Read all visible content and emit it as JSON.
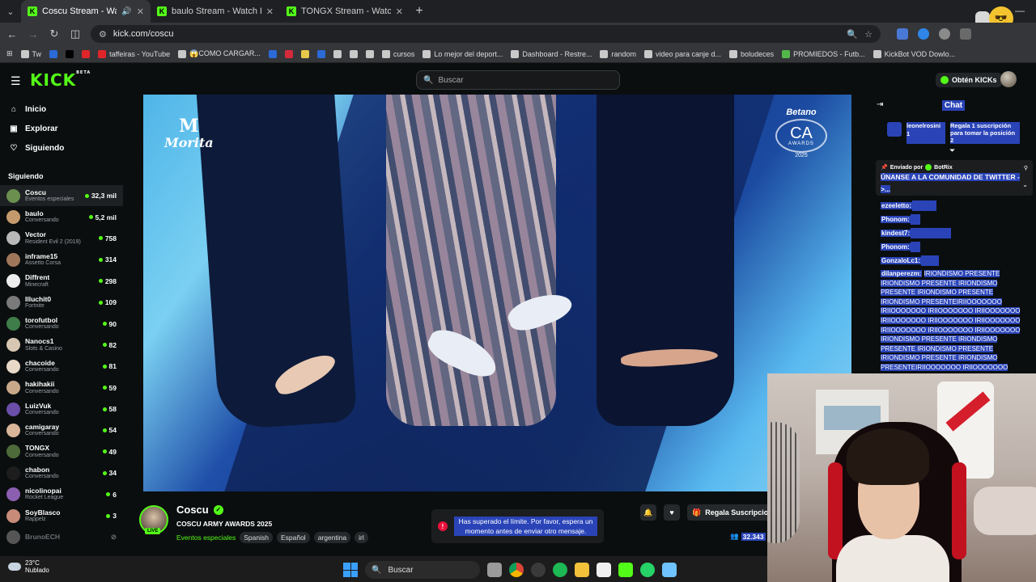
{
  "browser": {
    "tabs": [
      {
        "title": "Coscu Stream - Watch Live",
        "active": true,
        "audio": true
      },
      {
        "title": "baulo Stream - Watch Live on K",
        "active": false
      },
      {
        "title": "TONGX Stream - Watch Live on",
        "active": false
      }
    ],
    "url": "kick.com/coscu",
    "bookmarks": [
      {
        "label": "Tw",
        "color": "#c9c9c9"
      },
      {
        "label": "",
        "color": "#2b6ad7"
      },
      {
        "label": "",
        "color": "#000000"
      },
      {
        "label": "",
        "color": "#e0252a"
      },
      {
        "label": "taffeiras - YouTube",
        "color": "#e0252a"
      },
      {
        "label": "😱COMO CARGAR...",
        "color": "#c9c9c9"
      },
      {
        "label": "",
        "color": "#2b6ad7"
      },
      {
        "label": "",
        "color": "#d52a3c"
      },
      {
        "label": "",
        "color": "#e8c84a"
      },
      {
        "label": "",
        "color": "#2b6ad7"
      },
      {
        "label": "",
        "color": "#c9c9c9"
      },
      {
        "label": "",
        "color": "#c9c9c9"
      },
      {
        "label": "",
        "color": "#c9c9c9"
      },
      {
        "label": "cursos",
        "color": "#c9c9c9"
      },
      {
        "label": "Lo mejor del deport...",
        "color": "#c9c9c9"
      },
      {
        "label": "Dashboard - Restre...",
        "color": "#c9c9c9"
      },
      {
        "label": "random",
        "color": "#c9c9c9"
      },
      {
        "label": "video para canje d...",
        "color": "#c9c9c9"
      },
      {
        "label": "boludeces",
        "color": "#c9c9c9"
      },
      {
        "label": "PROMIEDOS - Futb...",
        "color": "#53b84a"
      },
      {
        "label": "KickBot VOD Dowlo...",
        "color": "#c9c9c9"
      }
    ]
  },
  "header": {
    "logo": "KICK",
    "logo_badge": "BETA",
    "search_placeholder": "Buscar",
    "kicks_button": "Obtén KICKs"
  },
  "sidebar": {
    "nav": [
      {
        "label": "Inicio",
        "icon": "home-icon",
        "glyph": "⌂"
      },
      {
        "label": "Explorar",
        "icon": "browse-icon",
        "glyph": "▣"
      },
      {
        "label": "Siguiendo",
        "icon": "heart-icon",
        "glyph": "♡"
      }
    ],
    "section_title": "Siguiendo",
    "following": [
      {
        "name": "Coscu",
        "category": "Eventos especiales",
        "viewers": "32,3 mil",
        "color": "#6b8f4e",
        "selected": true
      },
      {
        "name": "baulo",
        "category": "Conversando",
        "viewers": "5,2 mil",
        "color": "#c49a6c"
      },
      {
        "name": "Vector",
        "category": "Resident Evil 2 (2019)",
        "viewers": "758",
        "color": "#b8b8b8"
      },
      {
        "name": "inframe15",
        "category": "Assetto Corsa",
        "viewers": "314",
        "color": "#a0765a"
      },
      {
        "name": "Diffrent",
        "category": "Minecraft",
        "viewers": "298",
        "color": "#ededed"
      },
      {
        "name": "Illuchit0",
        "category": "Fortnite",
        "viewers": "109",
        "color": "#7a7a7a"
      },
      {
        "name": "torofutbol",
        "category": "Conversando",
        "viewers": "90",
        "color": "#3f7d4a"
      },
      {
        "name": "Nanocs1",
        "category": "Slots & Casino",
        "viewers": "82",
        "color": "#d7c7b2"
      },
      {
        "name": "chacoide",
        "category": "Conversando",
        "viewers": "81",
        "color": "#e8d9c8"
      },
      {
        "name": "hakihakii",
        "category": "Conversando",
        "viewers": "59",
        "color": "#c9a889"
      },
      {
        "name": "LuizVuk",
        "category": "Conversando",
        "viewers": "58",
        "color": "#6a4ea8"
      },
      {
        "name": "camigaray",
        "category": "Conversando",
        "viewers": "54",
        "color": "#d9b59a"
      },
      {
        "name": "TONGX",
        "category": "Conversando",
        "viewers": "49",
        "color": "#4d6b3a"
      },
      {
        "name": "chabon",
        "category": "Conversando",
        "viewers": "34",
        "color": "#1d1d1d"
      },
      {
        "name": "nicolinopai",
        "category": "Rocket League",
        "viewers": "6",
        "color": "#8a5fb0"
      },
      {
        "name": "SoyBlasco",
        "category": "Rappelz",
        "viewers": "3",
        "color": "#c78b7a"
      },
      {
        "name": "BrunoECH",
        "category": "",
        "viewers": "",
        "color": "#555555",
        "offline": true
      }
    ]
  },
  "video": {
    "watermark_left_mark": "M",
    "watermark_left_text": "Morita",
    "watermark_right_brand": "Betano",
    "watermark_right_mark": "CA",
    "watermark_right_sub": "AWARDS",
    "watermark_right_year": "2025"
  },
  "stream": {
    "channel": "Coscu",
    "live_badge": "LIVE",
    "title": "COSCU ARMY AWARDS 2025",
    "category": "Eventos especiales",
    "tags": [
      "Spanish",
      "Español",
      "argentina",
      "irl"
    ],
    "toast": "Has superado el límite. Por favor, espera un momento antes de enviar otro mensaje.",
    "gift_button": "Regala Suscripcio",
    "viewers": "32.343"
  },
  "chat": {
    "title": "Chat",
    "gifter_name": "leonelrosini 1",
    "gifter_message": "Regala 1 suscripción para tomar la posición 2",
    "pinned_by": "Enviado por",
    "pinned_bot": "BotRix",
    "pinned_message": "ÚNANSE A LA COMUNIDAD DE TWITTER ->...",
    "messages": [
      {
        "user": "ezeeletto:",
        "body": ""
      },
      {
        "user": "Phonom:",
        "body": ""
      },
      {
        "user": "kindest7:",
        "body": ""
      },
      {
        "user": "Phonom:",
        "body": ""
      },
      {
        "user": "GonzaloLc1:",
        "body": ""
      },
      {
        "user": "dilanperezm:",
        "body": "IRIONDISMO PRESENTE IRIONDISMO PRESENTE IRIONDISMO PRESENTE IRIONDISMO PRESENTE IRIONDISMO PRESENTEIRIIOOOOOOO IRIIOOOOOOO IRIIOOOOOOO IRIIOOOOOOO IRIIOOOOOOO IRIIOOOOOOO IRIIOOOOOOO IRIIOOOOOOO IRIIOOOOOOO IRIIOOOOOOO IRIONDISMO PRESENTE IRIONDISMO PRESENTE IRIONDISMO PRESENTE IRIONDISMO PRESENTE IRIONDISMO PRESENTEIRIIOOOOOOO IRIIOOOOOOO"
      }
    ]
  },
  "taskbar": {
    "weather_temp": "23°C",
    "weather_desc": "Nublado",
    "search": "Buscar"
  },
  "colors": {
    "kick_green": "#53fc18",
    "selection_blue": "#2a44b8",
    "bg": "#0b0e0f"
  }
}
